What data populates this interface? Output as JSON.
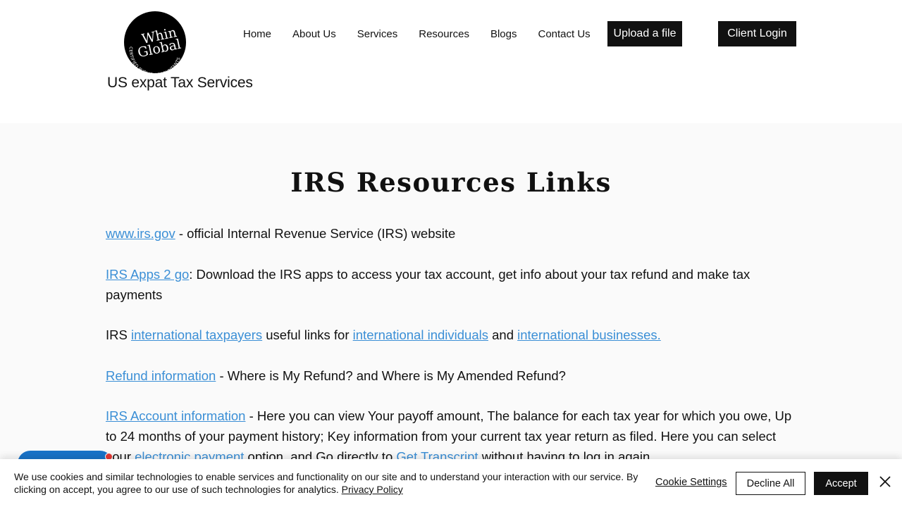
{
  "header": {
    "logo": {
      "word1": "Whin",
      "word2": "Global",
      "arc_text": "CERTIFIED PUBLIC ACCOUNTANTS"
    },
    "tagline": "US expat Tax Services",
    "nav": [
      {
        "label": "Home"
      },
      {
        "label": "About Us"
      },
      {
        "label": "Services"
      },
      {
        "label": "Resources"
      },
      {
        "label": "Blogs"
      },
      {
        "label": "Contact Us"
      }
    ],
    "upload_label": "Upload a file",
    "login_label": "Client Login"
  },
  "main": {
    "title": "IRS Resources Links",
    "p1": {
      "link": "www.irs.gov",
      "text": " - official Internal Revenue Service (IRS) website"
    },
    "p2": {
      "link": "IRS Apps 2 go",
      "text": ": Download the IRS apps to access your tax account, get info about your tax refund and make tax payments"
    },
    "p3": {
      "t1": "IRS ",
      "link1": "international taxpayers",
      "t2": " useful links for ",
      "link2": "international individuals",
      "t3": " and ",
      "link3": "international businesses."
    },
    "p4": {
      "link": "Refund information",
      "text": " - Where is My Refund? and Where is My Amended Refund?"
    },
    "p5": {
      "link1": "IRS Account information",
      "t1": " - Here you can view Your payoff amount, The balance for each tax year for which you owe, Up to 24 months of your payment history; Key information from your current tax year return as filed. Here you can select your ",
      "link2": "electronic payment",
      "t2": " option, and Go directly to ",
      "link3": "Get Transcript",
      "t3": " without having to log in again."
    }
  },
  "cookie": {
    "text": "We use cookies and similar technologies to enable services and functionality on our site and to understand your interaction with our service. By clicking on accept, you agree to our use of such technologies for analytics. ",
    "policy_link": "Privacy Policy",
    "settings_label": "Cookie Settings",
    "decline_label": "Decline All",
    "accept_label": "Accept",
    "close_icon": "close-icon"
  },
  "colors": {
    "link": "#3b8fd6",
    "button_dark": "#111111",
    "chat": "#1a73c8",
    "badge": "#e53935"
  }
}
